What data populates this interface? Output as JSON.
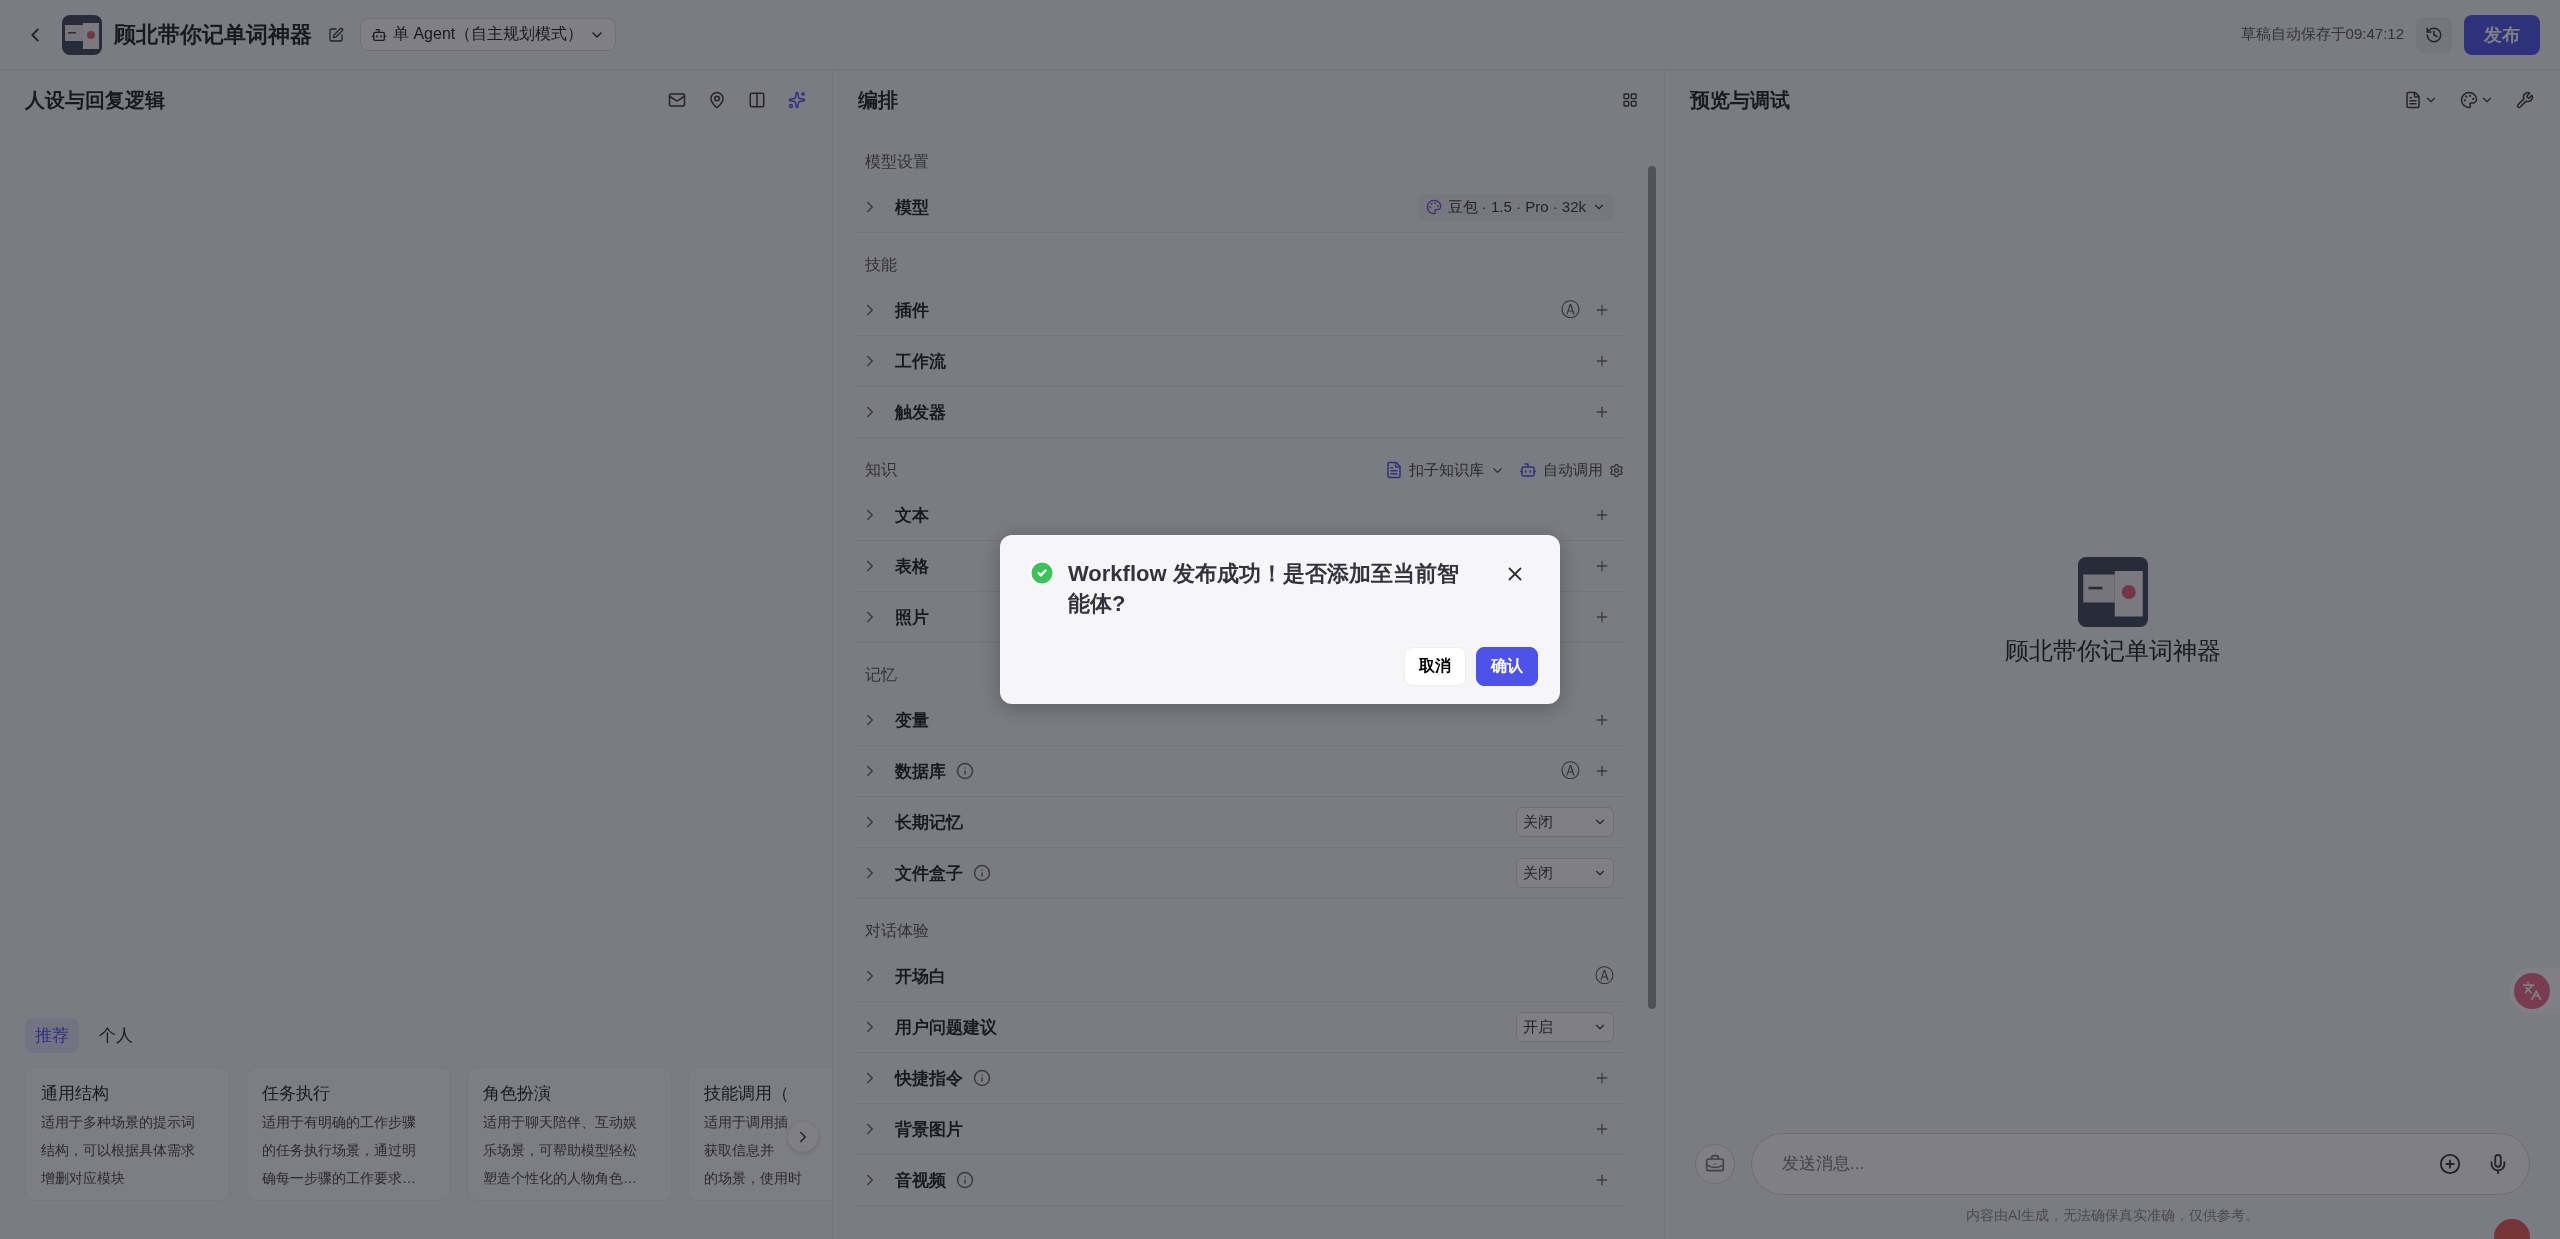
{
  "header": {
    "title": "顾北带你记单词神器",
    "agent_mode": "单 Agent（自主规划模式）",
    "autosave": "草稿自动保存于09:47:12",
    "publish": "发布"
  },
  "left_panel": {
    "title": "人设与回复逻辑",
    "tabs": [
      {
        "label": "推荐",
        "selected": true
      },
      {
        "label": "个人",
        "selected": false
      }
    ],
    "cards": [
      {
        "title": "通用结构",
        "lines": [
          "适用于多种场景的提示词",
          "结构，可以根据具体需求",
          "增删对应模块"
        ]
      },
      {
        "title": "任务执行",
        "lines": [
          "适用于有明确的工作步骤",
          "的任务执行场景，通过明",
          "确每一步骤的工作要求…"
        ]
      },
      {
        "title": "角色扮演",
        "lines": [
          "适用于聊天陪伴、互动娱",
          "乐场景，可帮助模型轻松",
          "塑造个性化的人物角色…"
        ]
      },
      {
        "title": "技能调用（",
        "lines": [
          "适用于调用插",
          "获取信息并",
          "的场景，使用时"
        ]
      }
    ]
  },
  "middle_panel": {
    "title": "编排",
    "sections": [
      {
        "title": "模型设置",
        "rows": [
          {
            "label": "模型",
            "info": false,
            "add": false,
            "model": "豆包 · 1.5 · Pro · 32k"
          }
        ]
      },
      {
        "title": "技能",
        "rows": [
          {
            "label": "插件",
            "info": false,
            "add": true,
            "badge": "Ⓐ"
          },
          {
            "label": "工作流",
            "info": false,
            "add": true
          },
          {
            "label": "触发器",
            "info": false,
            "add": true
          }
        ]
      },
      {
        "title": "知识",
        "source": "扣子知识库",
        "mode": "自动调用",
        "rows": [
          {
            "label": "文本",
            "info": false,
            "add": true
          },
          {
            "label": "表格",
            "info": false,
            "add": true
          },
          {
            "label": "照片",
            "info": false,
            "add": true
          }
        ]
      },
      {
        "title": "记忆",
        "rows": [
          {
            "label": "变量",
            "info": false,
            "add": true
          },
          {
            "label": "数据库",
            "info": true,
            "add": true,
            "badge": "Ⓐ"
          },
          {
            "label": "长期记忆",
            "info": false,
            "add": false,
            "select": "关闭"
          },
          {
            "label": "文件盒子",
            "info": true,
            "add": false,
            "select": "关闭"
          }
        ]
      },
      {
        "title": "对话体验",
        "rows": [
          {
            "label": "开场白",
            "info": false,
            "add": false,
            "badge": "Ⓐ"
          },
          {
            "label": "用户问题建议",
            "info": false,
            "add": false,
            "select": "开启"
          },
          {
            "label": "快捷指令",
            "info": true,
            "add": true
          },
          {
            "label": "背景图片",
            "info": false,
            "add": true
          },
          {
            "label": "音视频",
            "info": true,
            "add": true
          }
        ]
      }
    ]
  },
  "right_panel": {
    "title": "预览与调试",
    "agent_name": "顾北带你记单词神器",
    "input": {
      "placeholder": "发送消息..."
    },
    "disclaimer": "内容由AI生成，无法确保真实准确，仅供参考。"
  },
  "dialog": {
    "message": "Workflow 发布成功！是否添加至当前智能体?",
    "cancel": "取消",
    "confirm": "确认"
  }
}
